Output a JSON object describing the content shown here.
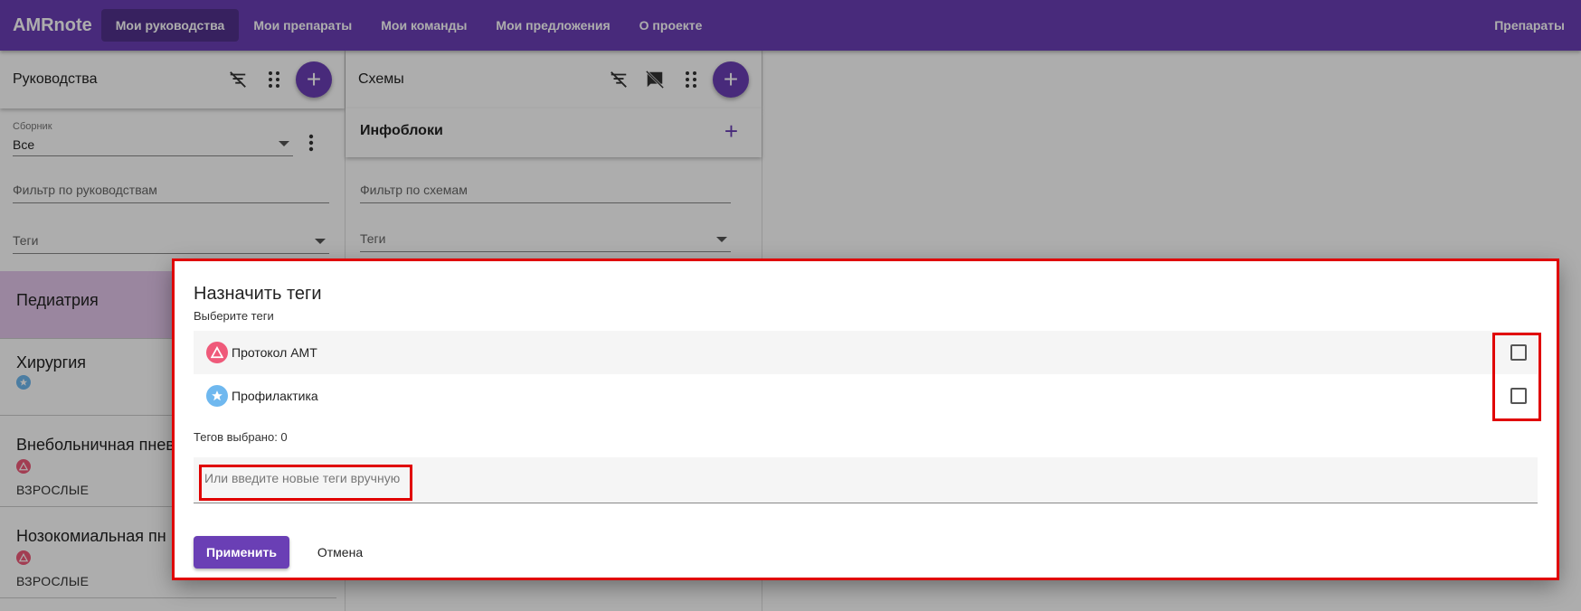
{
  "app": {
    "brand": "AMRnote",
    "nav": [
      "Мои руководства",
      "Мои препараты",
      "Мои команды",
      "Мои предложения",
      "О проекте"
    ],
    "right_nav": "Препараты"
  },
  "left_panel": {
    "title": "Руководства",
    "collection_label": "Сборник",
    "collection_value": "Все",
    "filter_placeholder": "Фильтр по руководствам",
    "tags_placeholder": "Теги",
    "items": [
      {
        "title": "Педиатрия",
        "sub": ""
      },
      {
        "title": "Хирургия",
        "sub": ""
      },
      {
        "title": "Внебольничная пнев",
        "sub": "ВЗРОСЛЫЕ"
      },
      {
        "title": "Нозокомиальная пн",
        "sub": "ВЗРОСЛЫЕ"
      }
    ]
  },
  "mid_panel": {
    "title": "Схемы",
    "infoblocks": "Инфоблоки",
    "filter_placeholder": "Фильтр по схемам",
    "tags_placeholder": "Теги"
  },
  "dialog": {
    "title": "Назначить теги",
    "subtitle": "Выберите теги",
    "tags": [
      {
        "label": "Протокол АМТ",
        "icon": "warning-triangle-icon",
        "color": "#ef5a7a",
        "checked": false
      },
      {
        "label": "Профилактика",
        "icon": "star-icon",
        "color": "#6fb8ef",
        "checked": false
      }
    ],
    "count_text": "Тегов выбрано: 0",
    "manual_placeholder": "Или введите новые теги вручную",
    "apply_label": "Применить",
    "cancel_label": "Отмена"
  },
  "colors": {
    "primary": "#6a3fb5",
    "highlight": "#e00000",
    "selected_item": "#e3c6ea"
  }
}
